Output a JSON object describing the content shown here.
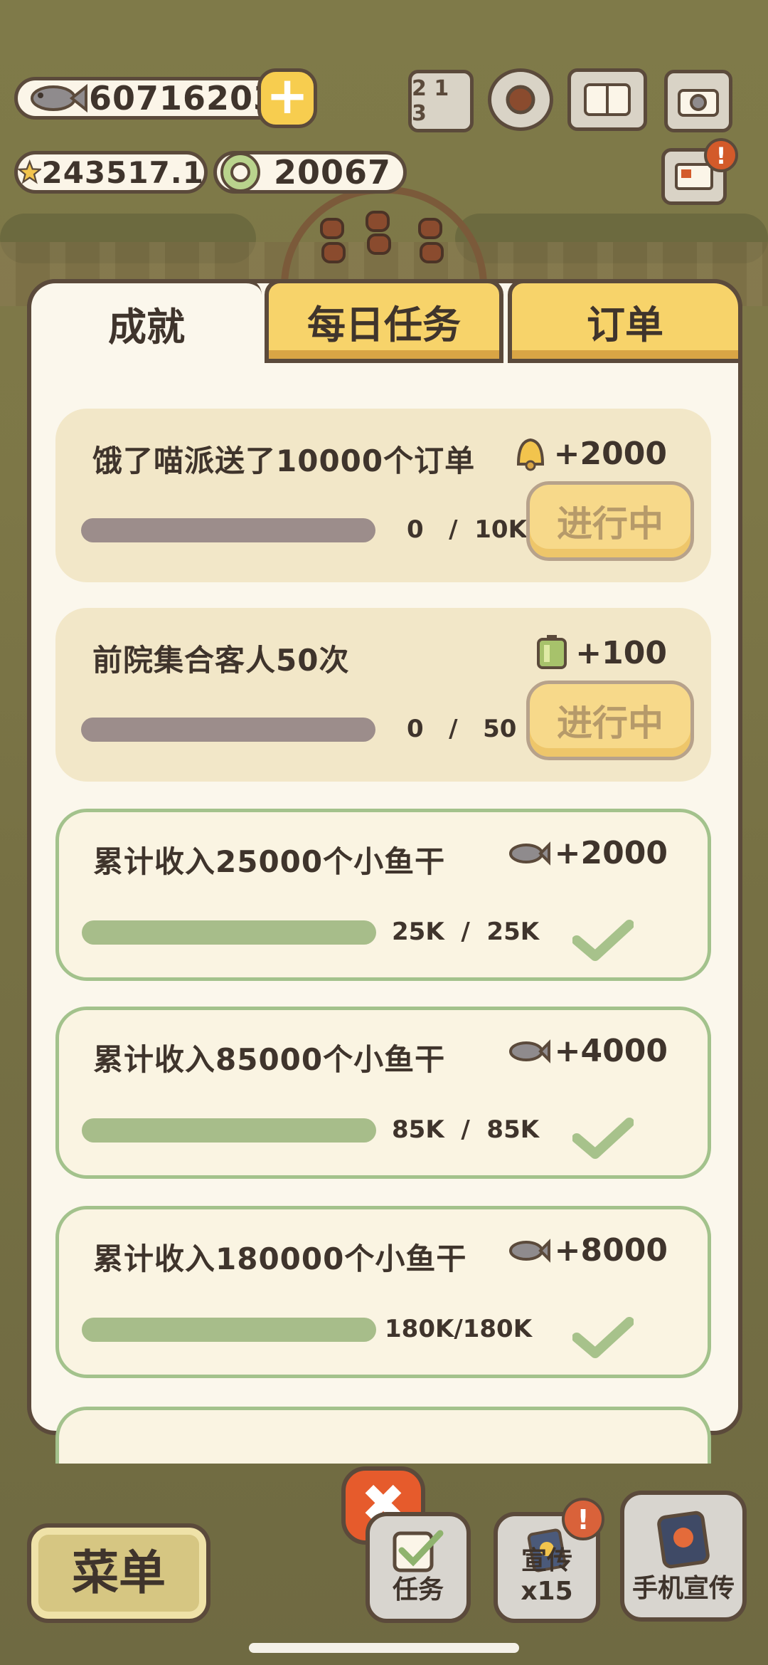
{
  "hud": {
    "fish_count": "607162030",
    "star_count": "243517.1",
    "ring_count": "20067",
    "icons": [
      "fish-icon",
      "plus-icon",
      "star-icon",
      "ring-icon",
      "leaderboard-icon",
      "gear-icon",
      "book-icon",
      "camera-icon",
      "mail-icon"
    ],
    "leaderboard_label": "2 1 3",
    "mail_badge": "!"
  },
  "tabs": [
    {
      "label": "成就",
      "active": true
    },
    {
      "label": "每日任务",
      "active": false
    },
    {
      "label": "订单",
      "active": false
    }
  ],
  "cards": [
    {
      "title": "饿了喵派送了10000个订单",
      "reward_icon": "bell-icon",
      "reward": "+2000",
      "progress": "0   /  10K",
      "progress_fraction": 0,
      "status": "进行中",
      "done": false
    },
    {
      "title": "前院集合客人50次",
      "reward_icon": "battery-icon",
      "reward": "+100",
      "progress": "0   /   50",
      "progress_fraction": 0,
      "status": "进行中",
      "done": false
    },
    {
      "title": "累计收入25000个小鱼干",
      "reward_icon": "fish-icon",
      "reward": "+2000",
      "progress": "25K  /  25K",
      "progress_fraction": 1,
      "done": true
    },
    {
      "title": "累计收入85000个小鱼干",
      "reward_icon": "fish-icon",
      "reward": "+4000",
      "progress": "85K  /  85K",
      "progress_fraction": 1,
      "done": true
    },
    {
      "title": "累计收入180000个小鱼干",
      "reward_icon": "fish-icon",
      "reward": "+8000",
      "progress": "180K/180K",
      "progress_fraction": 1,
      "done": true
    }
  ],
  "bottom": {
    "close": "✖",
    "menu": "菜单",
    "task": "任务",
    "promo": "宣传x15",
    "promo_badge": "!",
    "phone_promo": "手机宣传"
  },
  "colors": {
    "accent_yellow": "#f7d36a",
    "done_green": "#a7bd8a",
    "close_orange": "#e65b2c",
    "outline": "#5b4a3b"
  }
}
